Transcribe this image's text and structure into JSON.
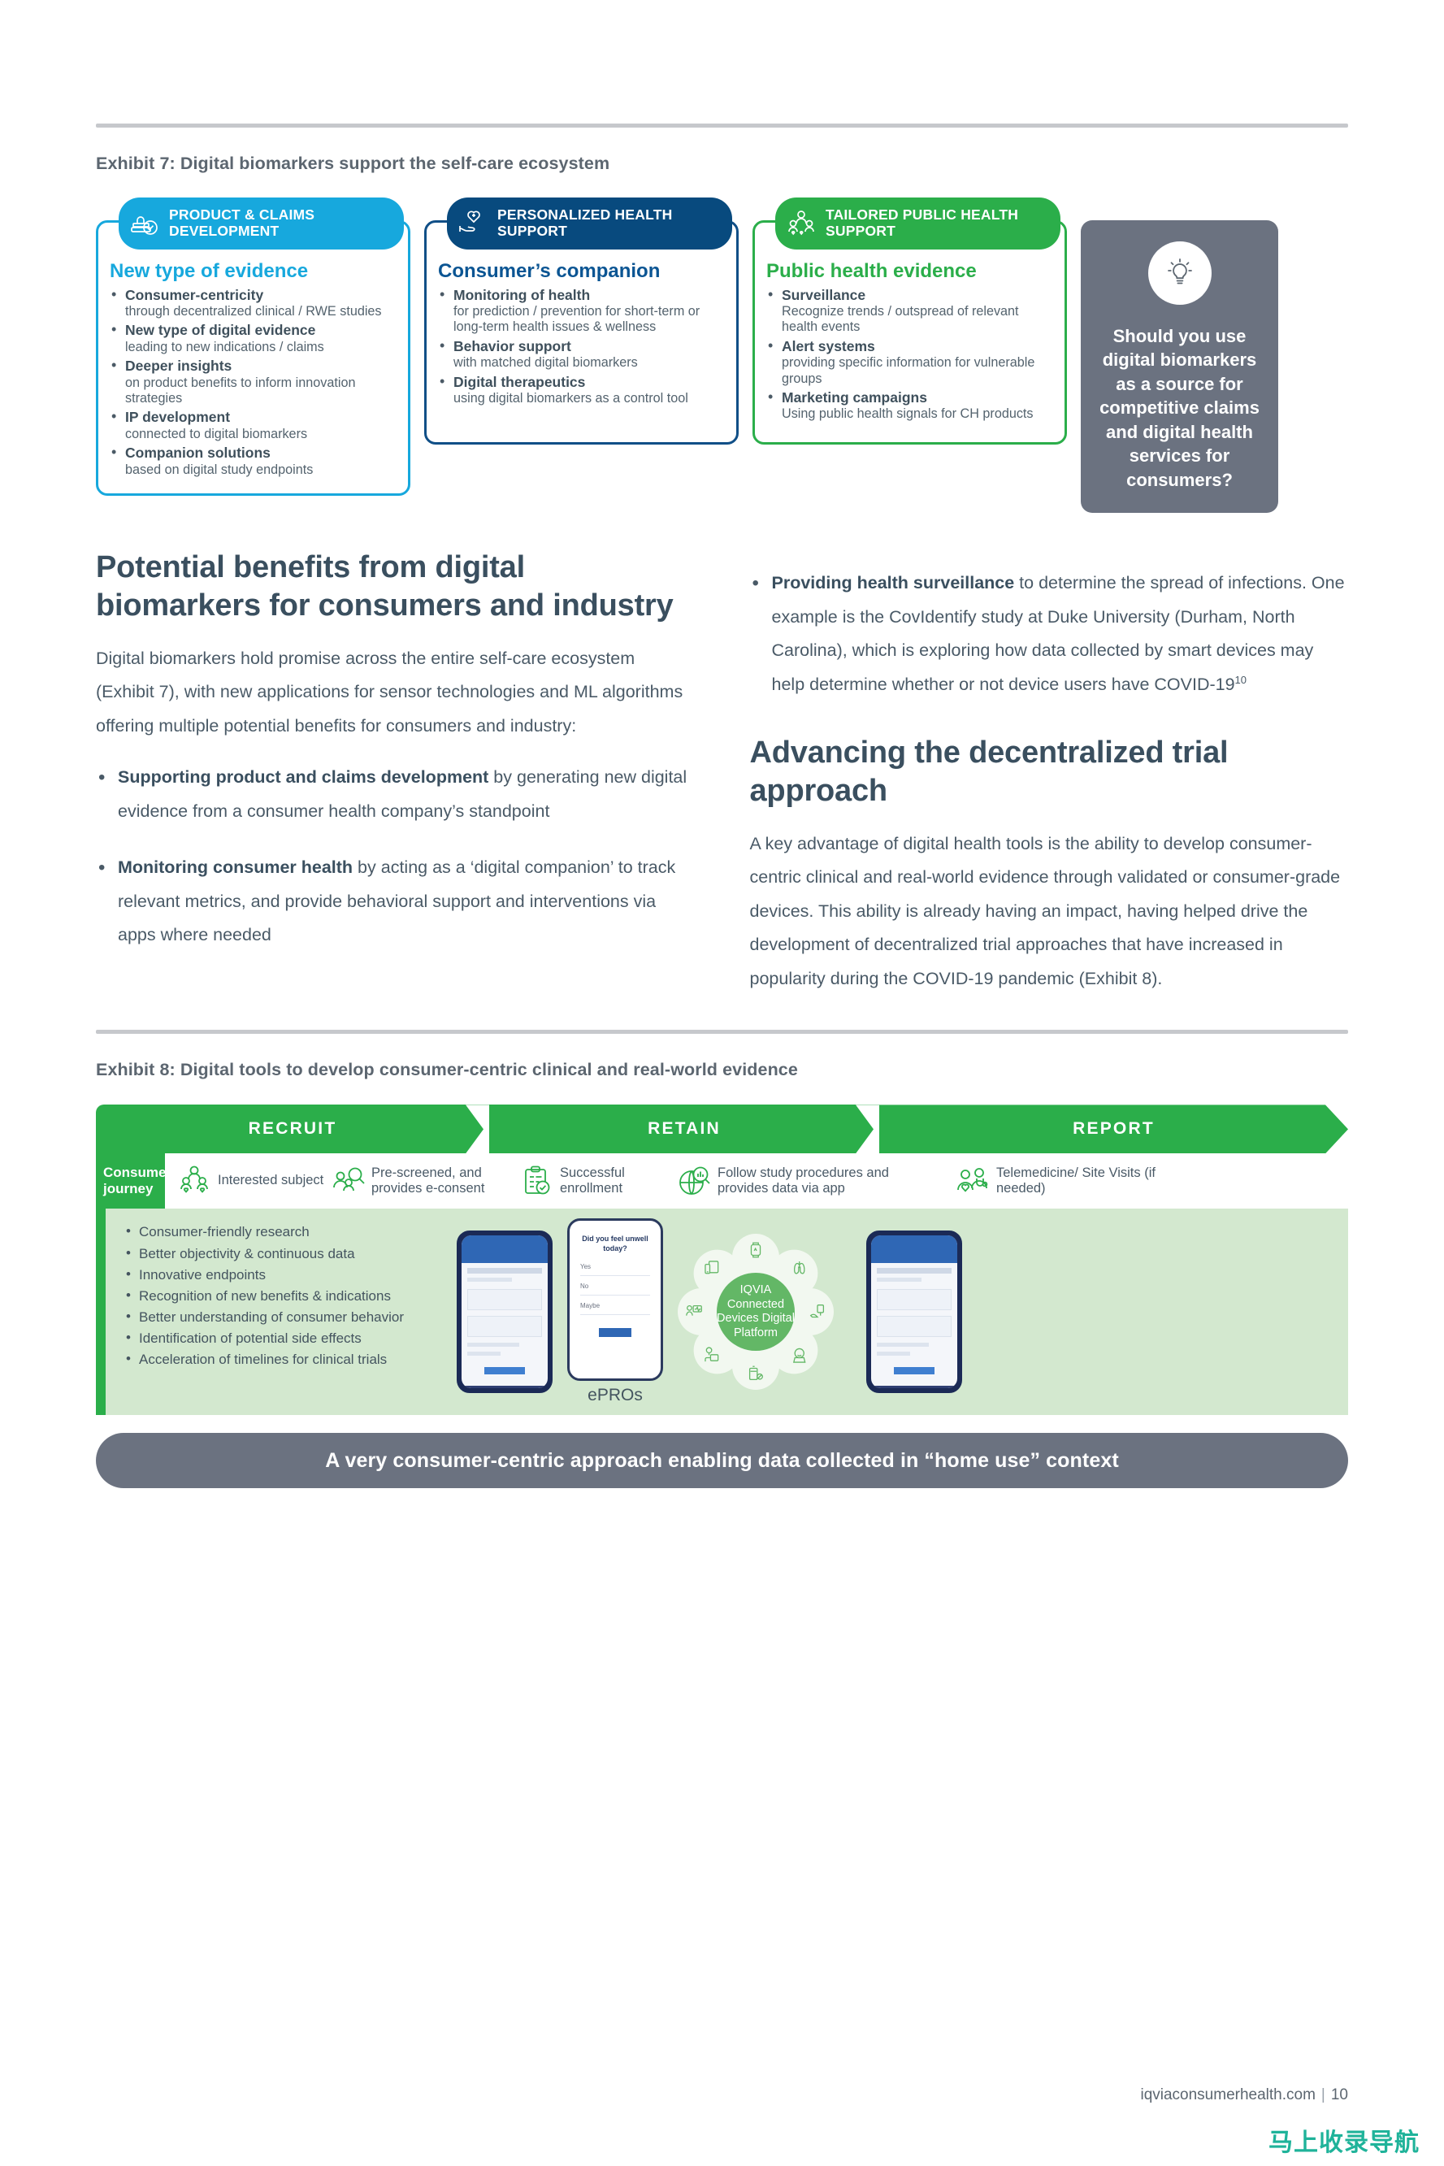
{
  "exhibit7": {
    "title": "Exhibit 7: Digital biomarkers support the self-care ecosystem",
    "cards": [
      {
        "tab": "PRODUCT & CLAIMS DEVELOPMENT",
        "icon": "stamp-check-icon",
        "heading": "New type of evidence",
        "color": "#17a8dd",
        "items": [
          {
            "bold": "Consumer-centricity",
            "sub": "through decentralized clinical / RWE studies"
          },
          {
            "bold": "New type of digital evidence",
            "sub": "leading to new indications / claims"
          },
          {
            "bold": "Deeper insights",
            "sub": "on product benefits to inform innovation strategies"
          },
          {
            "bold": "IP development",
            "sub": "connected to digital biomarkers"
          },
          {
            "bold": "Companion solutions",
            "sub": "based on digital study endpoints"
          }
        ]
      },
      {
        "tab": "PERSONALIZED HEALTH SUPPORT",
        "icon": "heart-in-hand-icon",
        "heading": "Consumer’s companion",
        "color": "#0b5593",
        "items": [
          {
            "bold": "Monitoring of health",
            "sub": "for prediction / prevention for short-term or long-term health issues & wellness"
          },
          {
            "bold": "Behavior support",
            "sub": "with matched digital biomarkers"
          },
          {
            "bold": "Digital therapeutics",
            "sub": "using digital biomarkers as a control tool"
          }
        ]
      },
      {
        "tab": "TAILORED PUBLIC HEALTH SUPPORT",
        "icon": "people-group-icon",
        "heading": "Public health evidence",
        "color": "#2bae4a",
        "items": [
          {
            "bold": "Surveillance",
            "sub": "Recognize trends / outspread of relevant health events"
          },
          {
            "bold": "Alert systems",
            "sub": "providing specific information for vulnerable groups"
          },
          {
            "bold": "Marketing campaigns",
            "sub": "Using public health signals for CH products"
          }
        ]
      }
    ],
    "question_card": {
      "icon": "lightbulb-icon",
      "text": "Should you use digital biomarkers as a source for competitive claims and digital health services for consumers?",
      "background": "#6b7280"
    }
  },
  "left_column": {
    "heading": "Potential benefits from digital biomarkers for consumers and industry",
    "paragraph": "Digital biomarkers hold promise across the entire self-care ecosystem (Exhibit 7), with new applications for sensor technologies and ML algorithms offering multiple potential benefits for consumers and industry:",
    "bullets": [
      {
        "bold": "Supporting product and claims development",
        "rest": " by generating new digital evidence from a consumer health company’s standpoint"
      },
      {
        "bold": "Monitoring consumer health",
        "rest": " by acting as a ‘digital companion’ to track relevant metrics, and provide behavioral support and interventions via apps where needed"
      }
    ]
  },
  "right_column": {
    "bullet": {
      "bold": "Providing health surveillance",
      "rest": " to determine the spread of infections. One example is the CovIdentify study at Duke University (Durham, North Carolina), which is exploring how data collected by smart devices may help determine whether or not device users have COVID-19",
      "footnote": "10"
    },
    "heading": "Advancing the decentralized trial approach",
    "paragraph": "A key advantage of digital health tools is the ability to develop consumer-centric clinical and real-world evidence through validated or consumer-grade devices. This ability is already having an impact, having helped drive the development of decentralized trial approaches that have increased in popularity during the COVID-19 pandemic (Exhibit 8)."
  },
  "exhibit8": {
    "title": "Exhibit 8: Digital tools to develop consumer-centric clinical and real-world evidence",
    "phases": [
      "RECRUIT",
      "RETAIN",
      "REPORT"
    ],
    "journey_label": "Consumer journey",
    "steps": [
      {
        "icon": "people-heart-icon",
        "text": "Interested subject"
      },
      {
        "icon": "people-search-icon",
        "text": "Pre-screened, and provides e-consent"
      },
      {
        "icon": "clipboard-check-icon",
        "text": "Successful enrollment"
      },
      {
        "icon": "globe-chart-search-icon",
        "text": "Follow study procedures and provides data via app"
      },
      {
        "icon": "doctor-patient-icon",
        "text": "Telemedicine/ Site Visits (if needed)"
      }
    ],
    "benefits": [
      "Consumer-friendly research",
      "Better objectivity & continuous data",
      "Innovative endpoints",
      "Recognition of new benefits & indications",
      "Better understanding of consumer behavior",
      "Identification of potential side effects",
      "Acceleration of timelines for clinical trials"
    ],
    "phone2_question": "Did you feel unwell today?",
    "epro_label": "ePROs",
    "flower_core": "IQVIA Connected Devices Digital Platform",
    "flower_icons": [
      "smartwatch-icon",
      "lungs-icon",
      "injector-pen-icon",
      "inhaler-mask-icon",
      "pill-bottle-icon",
      "blood-pressure-cuff-icon",
      "patient-monitor-icon",
      "tablet-phone-icon"
    ],
    "banner": "A very consumer-centric approach enabling data collected in “home use” context"
  },
  "footer": {
    "site": "iqviaconsumerhealth.com",
    "page": "10"
  },
  "watermark": "马上收录导航"
}
